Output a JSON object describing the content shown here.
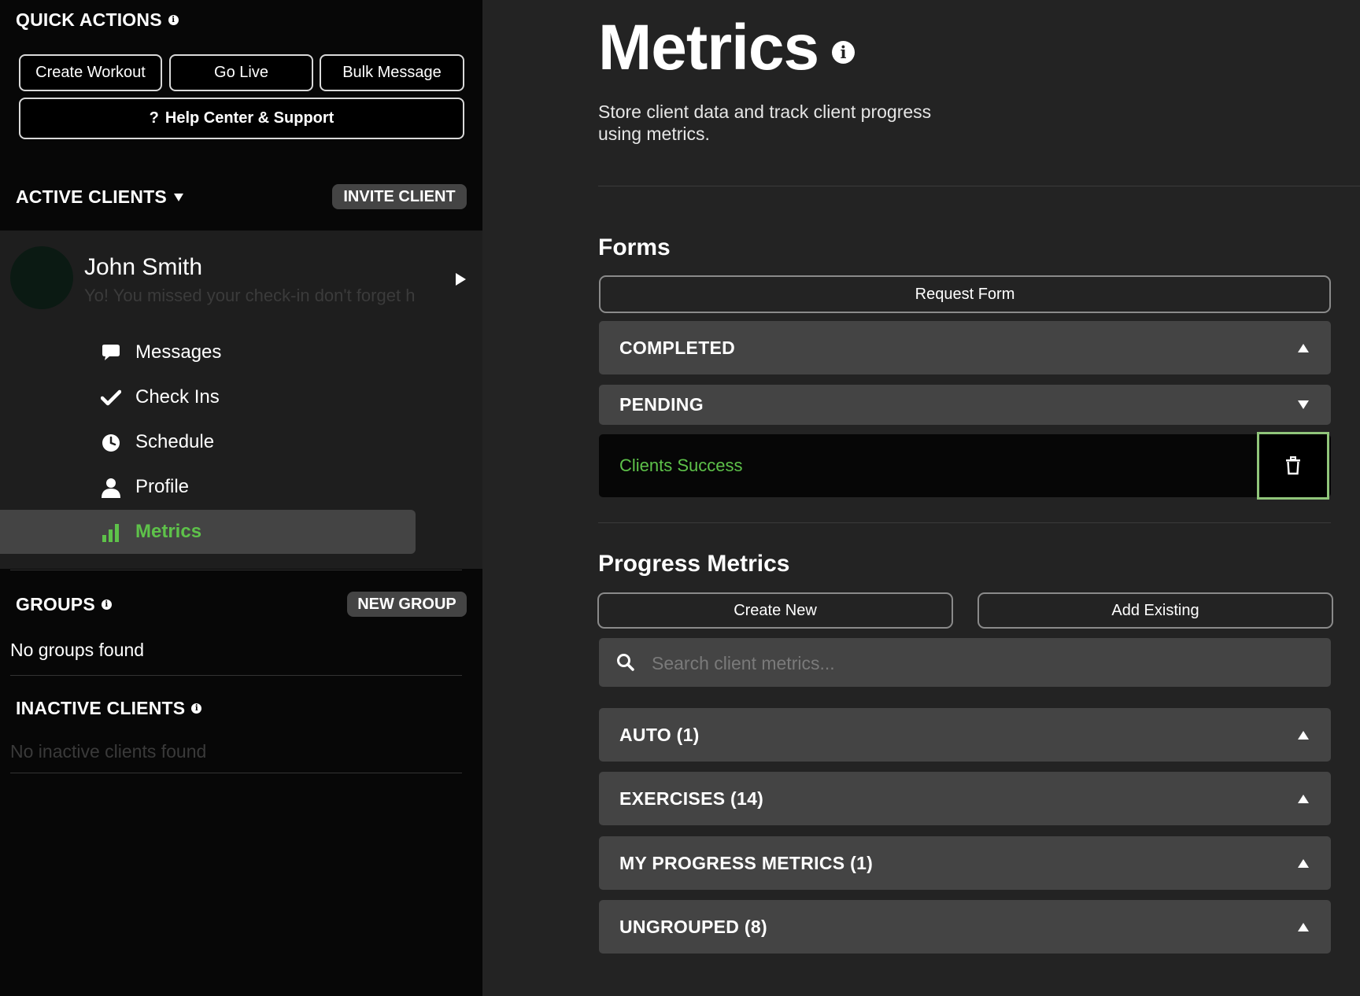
{
  "sidebar": {
    "quick_actions": {
      "title": "QUICK ACTIONS",
      "create_workout": "Create Workout",
      "go_live": "Go Live",
      "bulk_message": "Bulk Message",
      "help_center": "Help Center & Support",
      "help_prefix": "?"
    },
    "active_clients": {
      "title": "ACTIVE CLIENTS",
      "invite_label": "INVITE CLIENT"
    },
    "client": {
      "name": "John Smith",
      "last_message": "Yo! You missed your check-in don't forget h"
    },
    "nav": [
      {
        "label": "Messages",
        "icon": "chat-icon"
      },
      {
        "label": "Check Ins",
        "icon": "check-icon"
      },
      {
        "label": "Schedule",
        "icon": "clock-icon"
      },
      {
        "label": "Profile",
        "icon": "user-icon"
      },
      {
        "label": "Metrics",
        "icon": "bar-chart-icon",
        "active": true
      }
    ],
    "groups": {
      "title": "GROUPS",
      "new_label": "NEW GROUP",
      "empty": "No groups found"
    },
    "inactive": {
      "title": "INACTIVE CLIENTS",
      "empty": "No inactive clients found"
    }
  },
  "main": {
    "title": "Metrics",
    "subtitle": "Store client data and track client progress using metrics.",
    "forms": {
      "title": "Forms",
      "request_label": "Request Form",
      "sections": [
        {
          "label": "COMPLETED",
          "expanded": false
        },
        {
          "label": "PENDING",
          "expanded": true
        }
      ],
      "pending_items": [
        {
          "name": "Clients Success"
        }
      ]
    },
    "progress": {
      "title": "Progress Metrics",
      "create_label": "Create New",
      "add_label": "Add Existing",
      "search_placeholder": "Search client metrics...",
      "groups": [
        {
          "label": "AUTO (1)"
        },
        {
          "label": "EXERCISES (14)"
        },
        {
          "label": "MY PROGRESS METRICS (1)"
        },
        {
          "label": "UNGROUPED (8)"
        }
      ]
    }
  },
  "colors": {
    "accent_green": "#5ec24a",
    "trash_border": "#90c57a",
    "sidebar_bg": "#070707",
    "main_bg": "#232323",
    "accordion_bg": "#444444"
  }
}
